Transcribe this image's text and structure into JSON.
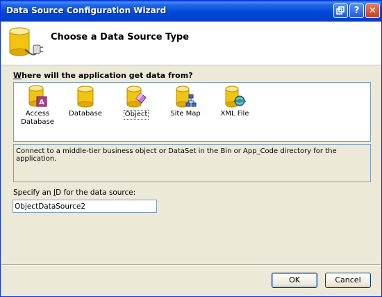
{
  "window": {
    "title": "Data Source Configuration Wizard"
  },
  "titlebar": {
    "help_icon": "help-icon",
    "close_icon": "close-icon",
    "min_icon": "restore-icon"
  },
  "header": {
    "title": "Choose a Data Source Type",
    "icon": "database-plug-icon"
  },
  "question": {
    "underlined_letter": "W",
    "rest": "here will the application get data from?"
  },
  "sources": [
    {
      "label": "Access Database",
      "icon": "access-database-icon"
    },
    {
      "label": "Database",
      "icon": "database-icon"
    },
    {
      "label": "Object",
      "icon": "object-icon",
      "selected": true
    },
    {
      "label": "Site Map",
      "icon": "site-map-icon"
    },
    {
      "label": "XML File",
      "icon": "xml-file-icon"
    }
  ],
  "description": "Connect to a middle-tier business object or DataSet in the Bin or App_Code directory for the application.",
  "id_label_before": "Specify an ",
  "id_label_underlined": "I",
  "id_label_after": "D for the data source:",
  "id_value": "ObjectDataSource2",
  "buttons": {
    "ok": "OK",
    "cancel": "Cancel"
  }
}
